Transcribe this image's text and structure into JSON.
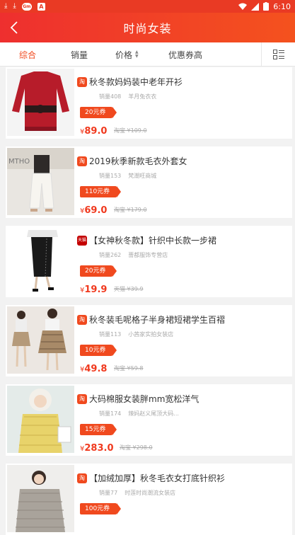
{
  "status_bar": {
    "time": "6:10",
    "app_badge": "Gm"
  },
  "header": {
    "title": "时尚女装"
  },
  "filter_tabs": [
    {
      "label": "综合",
      "active": true
    },
    {
      "label": "销量",
      "active": false
    },
    {
      "label": "价格",
      "active": false
    },
    {
      "label": "优惠券高",
      "active": false
    }
  ],
  "colors": {
    "accent": "#f0491e",
    "header_start": "#ee2f2f",
    "header_end": "#f4521e"
  },
  "products": [
    {
      "badge": "淘",
      "title": "秋冬款妈妈装中老年开衫",
      "sales": "销量408",
      "shop": "羊月兔衣衣",
      "coupon": "20元券",
      "price": "89.0",
      "original": "淘宝 ¥109.0",
      "image": "red-cardigan-photo"
    },
    {
      "badge": "淘",
      "title": "2019秋季新款毛衣外套女",
      "sales": "销量153",
      "shop": "梵潮旺商城",
      "coupon": "110元券",
      "price": "69.0",
      "original": "淘宝 ¥179.0",
      "image": "white-pants-photo"
    },
    {
      "badge": "天猫",
      "title": "【女神秋冬款】针织中长款一步裙",
      "sales": "销量262",
      "shop": "蔷都服饰专营店",
      "coupon": "20元券",
      "price": "19.9",
      "original": "天猫 ¥39.9",
      "image": "black-skirt-photo"
    },
    {
      "badge": "淘",
      "title": "秋冬装毛呢格子半身裙短裙学生百褶",
      "sales": "销量113",
      "shop": "小茜家实拍女装店",
      "coupon": "10元券",
      "price": "49.8",
      "original": "淘宝 ¥59.8",
      "image": "plaid-skirt-photo"
    },
    {
      "badge": "淘",
      "title": "大码棉服女装胖mm宽松洋气",
      "sales": "销量174",
      "shop": "辣妈赵义尾顶大码...",
      "coupon": "15元券",
      "price": "283.0",
      "original": "淘宝 ¥298.0",
      "image": "yellow-coat-photo"
    },
    {
      "badge": "淘",
      "title": "【加绒加厚】秋冬毛衣女打底针织衫",
      "sales": "销量77",
      "shop": "时莲时尚潮流女装店",
      "coupon": "100元券",
      "price": "",
      "original": "",
      "image": "grey-sweater-photo"
    }
  ]
}
